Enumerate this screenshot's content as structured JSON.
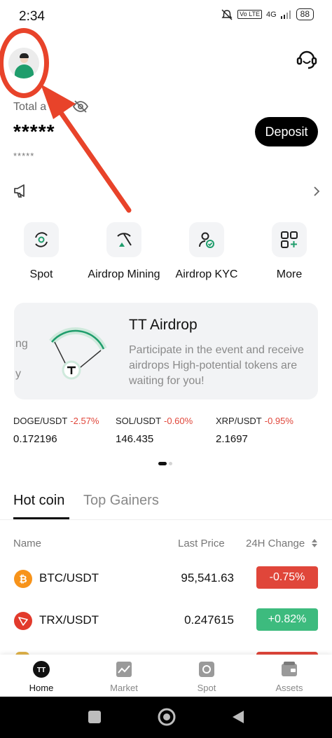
{
  "status_bar": {
    "time": "2:34",
    "volte": "Vo LTE",
    "network": "4G",
    "battery": "88"
  },
  "header": {
    "total_assets_label": "Total a",
    "balance_masked": "*****",
    "sub_balance_masked": "*****",
    "deposit_label": "Deposit"
  },
  "quick_actions": [
    {
      "label": "Spot",
      "icon": "spot-icon"
    },
    {
      "label": "Airdrop Mining",
      "icon": "pickaxe-icon"
    },
    {
      "label": "Airdrop KYC",
      "icon": "user-verify-icon"
    },
    {
      "label": "More",
      "icon": "grid-plus-icon"
    }
  ],
  "banner": {
    "title": "TT Airdrop",
    "description": "Participate in the event and receive airdrops High-potential tokens are waiting for you!",
    "side_text_1": "ng",
    "side_text_2": "y"
  },
  "tickers": [
    {
      "pair": "DOGE/USDT",
      "change": "-2.57%",
      "price": "0.172196"
    },
    {
      "pair": "SOL/USDT",
      "change": "-0.60%",
      "price": "146.435"
    },
    {
      "pair": "XRP/USDT",
      "change": "-0.95%",
      "price": "2.1697"
    }
  ],
  "tabs": {
    "hot_coin": "Hot coin",
    "top_gainers": "Top Gainers"
  },
  "table": {
    "headers": {
      "name": "Name",
      "last_price": "Last Price",
      "change": "24H Change"
    },
    "rows": [
      {
        "symbol": "BTC/USDT",
        "last_price": "95,541.63",
        "change": "-0.75%",
        "icon": "bitcoin-icon",
        "icon_glyph": "₿",
        "icon_color": "#f7931a",
        "change_color": "#e0463a"
      },
      {
        "symbol": "TRX/USDT",
        "last_price": "0.247615",
        "change": "+0.82%",
        "icon": "tron-icon",
        "icon_glyph": "",
        "icon_color": "#e23a2c",
        "change_color": "#3dbb7e"
      }
    ]
  },
  "bottom_nav": [
    {
      "label": "Home",
      "icon": "home-icon",
      "active": true
    },
    {
      "label": "Market",
      "icon": "market-icon",
      "active": false
    },
    {
      "label": "Spot",
      "icon": "spot-nav-icon",
      "active": false
    },
    {
      "label": "Assets",
      "icon": "wallet-icon",
      "active": false
    }
  ],
  "colors": {
    "negative": "#e0463a",
    "positive": "#3dbb7e",
    "annotation": "#e8432a",
    "brand_green": "#1f9d6c"
  }
}
